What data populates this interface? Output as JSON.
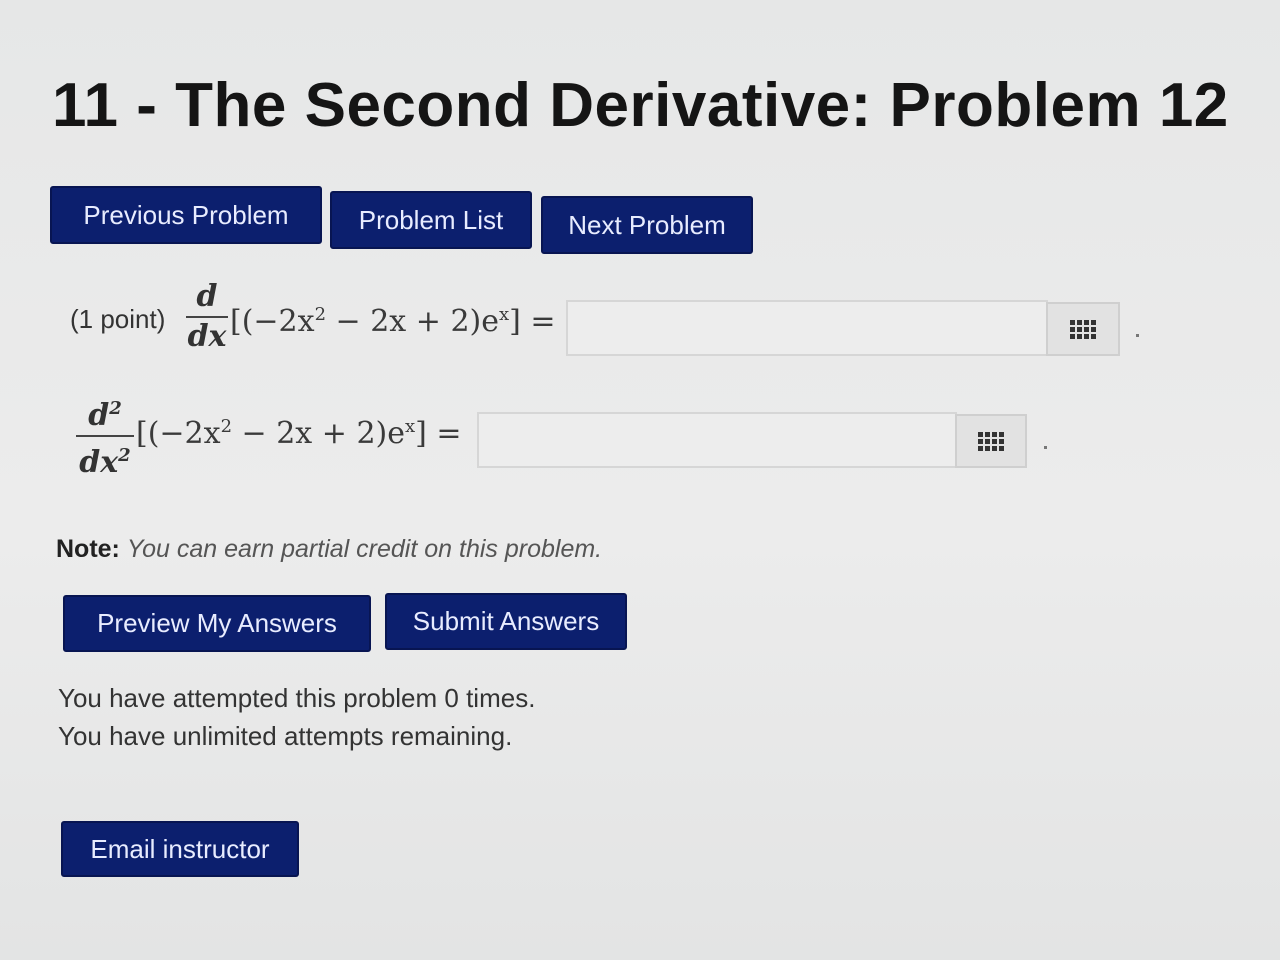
{
  "header": {
    "title": "11 - The Second Derivative: Problem 12"
  },
  "nav": {
    "previous_label": "Previous Problem",
    "list_label": "Problem List",
    "next_label": "Next Problem"
  },
  "problem": {
    "points": "(1 point)",
    "q1": {
      "operator_num": "d",
      "operator_den": "dx",
      "expression_open": "[(−2x",
      "exp1": "2",
      "expression_mid": " − 2x + 2)e",
      "exp2": "x",
      "expression_close": "] =",
      "answer_value": ""
    },
    "q2": {
      "operator_num_base": "d",
      "operator_num_exp": "2",
      "operator_den_base": "dx",
      "operator_den_exp": "2",
      "expression_open": "[(−2x",
      "exp1": "2",
      "expression_mid": " − 2x + 2)e",
      "exp2": "x",
      "expression_close": "] =",
      "answer_value": ""
    }
  },
  "note": {
    "label": "Note:",
    "text": "You can earn partial credit on this problem."
  },
  "actions": {
    "preview_label": "Preview My Answers",
    "submit_label": "Submit Answers",
    "email_label": "Email instructor"
  },
  "status": {
    "attempts": "You have attempted this problem 0 times.",
    "remaining": "You have unlimited attempts remaining."
  },
  "icons": {
    "palette": "equation-palette-icon"
  },
  "colors": {
    "button_bg": "#0c1f6e",
    "button_text": "#e8ecff"
  }
}
